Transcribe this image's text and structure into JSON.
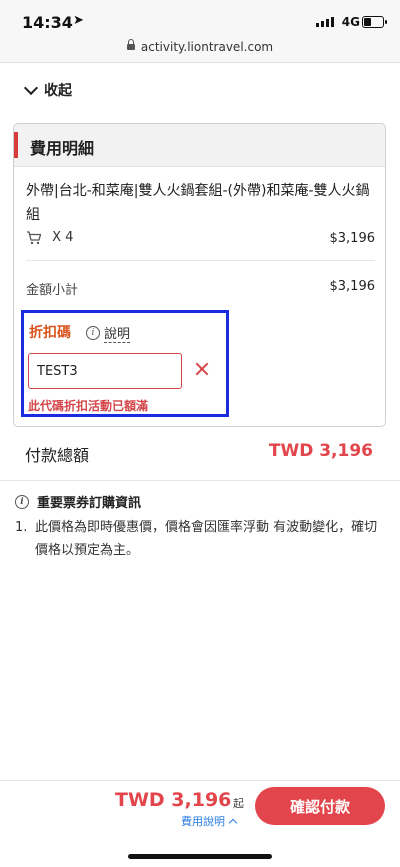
{
  "status_bar": {
    "time": "14:34",
    "location_arrow": "➤",
    "network": "4G"
  },
  "url_bar": {
    "url": "activity.liontravel.com"
  },
  "collapse": {
    "label": "收起"
  },
  "fee_details": {
    "title": "費用明細",
    "product_name": "外帶|台北-和菜庵|雙人火鍋套組-(外帶)和菜庵-雙人火鍋組",
    "quantity": "X 4",
    "item_price": "$3,196",
    "subtotal_label": "金額小計",
    "subtotal_value": "$3,196",
    "discount": {
      "title": "折扣碼",
      "info_label": "說明",
      "code_value": "TEST3",
      "error_message": "此代碼折扣活動已額滿"
    },
    "total_label": "付款總額",
    "total_value": "TWD 3,196"
  },
  "notice": {
    "title": "重要票券訂購資訊",
    "items": [
      {
        "num": "1.",
        "text": "此價格為即時優惠價，價格會因匯率浮動 有波動變化，確切價格以預定為主。"
      }
    ]
  },
  "bottom_bar": {
    "price": "TWD 3,196",
    "suffix": "起",
    "fee_link": "費用說明",
    "confirm_label": "確認付款"
  },
  "colors": {
    "accent_red": "#e2454b",
    "discount_orange": "#d9541e",
    "highlight_blue": "#1a2be0",
    "link_blue": "#2a7de1"
  },
  "icons": [
    "location-arrow-icon",
    "signal-icon",
    "battery-icon",
    "lock-icon",
    "chevron-down-icon",
    "cart-icon",
    "info-icon",
    "close-icon",
    "chevron-up-icon"
  ]
}
